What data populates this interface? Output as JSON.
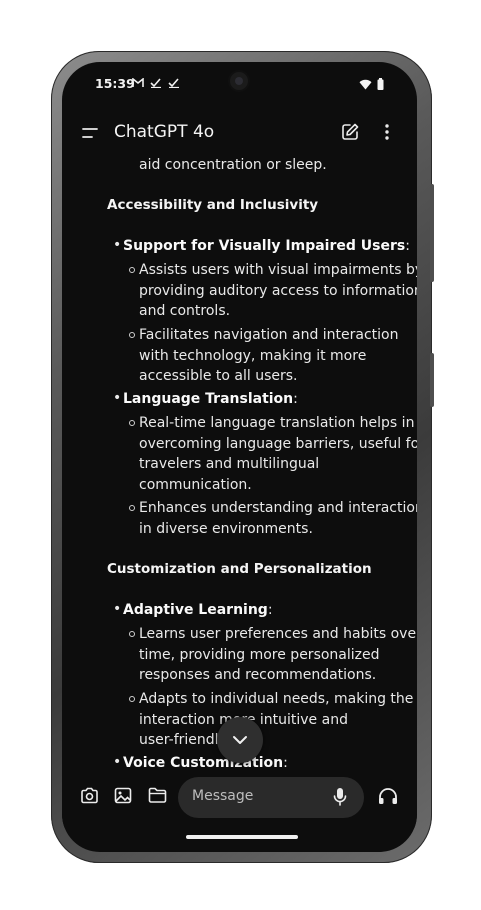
{
  "status_bar": {
    "time": "15:39",
    "left_icons": [
      "gmail-icon",
      "check-icon",
      "check-icon"
    ],
    "right_icons": [
      "wifi-icon",
      "battery-icon"
    ]
  },
  "app_bar": {
    "title": "ChatGPT 4o",
    "icons": [
      "menu-icon",
      "edit-icon",
      "more-vert-icon"
    ]
  },
  "content": {
    "fragment": "aid concentration or sleep.",
    "sections": [
      {
        "heading": "Accessibility and Inclusivity",
        "items": [
          {
            "title": "Support for Visually Impaired Users",
            "suffix": ":",
            "subs": [
              [
                "Assists users with visual impairments by",
                "providing auditory access to information",
                "and controls."
              ],
              [
                "Facilitates navigation and interaction",
                "with technology, making it more",
                "accessible to all users."
              ]
            ]
          },
          {
            "title": "Language Translation",
            "suffix": ":",
            "subs": [
              [
                "Real-time language translation helps in",
                "overcoming language barriers, useful for",
                "travelers and multilingual",
                "communication."
              ],
              [
                "Enhances understanding and interaction",
                "in diverse environments."
              ]
            ]
          }
        ]
      },
      {
        "heading": "Customization and Personalization",
        "items": [
          {
            "title": "Adaptive Learning",
            "suffix": ":",
            "subs": [
              [
                "Learns user preferences and habits over",
                "time, providing more personalized",
                "responses and recommendations."
              ],
              [
                "Adapts to individual needs, making the",
                "interaction more intuitive and",
                "user-friendly."
              ]
            ]
          },
          {
            "title": "Voice Customization",
            "suffix": ":",
            "subs": []
          }
        ]
      }
    ]
  },
  "composer": {
    "placeholder": "Message",
    "icons": [
      "camera-icon",
      "image-icon",
      "folder-icon",
      "mic-icon",
      "headphones-icon"
    ]
  },
  "scroll_button_icon": "chevron-down-icon",
  "colors": {
    "background": "#0d0d0d",
    "text": "#ececec",
    "input_background": "#2a2a2a"
  }
}
